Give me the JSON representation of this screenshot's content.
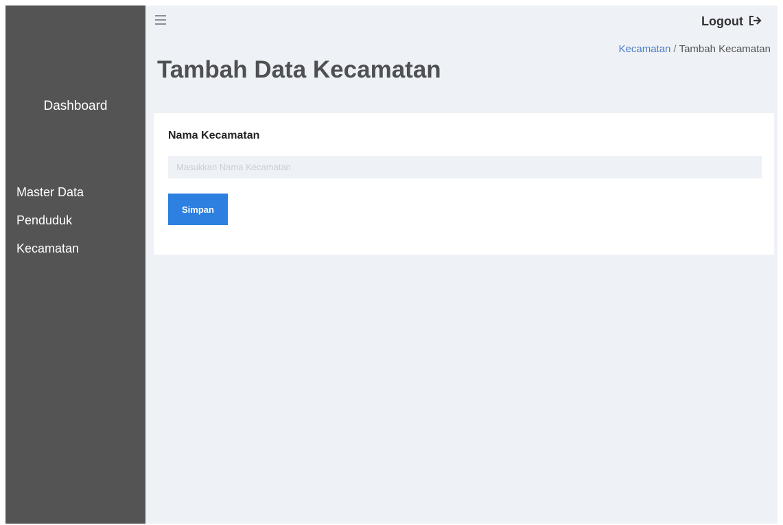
{
  "sidebar": {
    "brand": "Dashboard",
    "section_title": "Master Data",
    "items": [
      {
        "label": "Penduduk"
      },
      {
        "label": "Kecamatan"
      }
    ]
  },
  "header": {
    "menu_icon": "hamburger-icon",
    "logout_label": "Logout",
    "logout_icon": "sign-out-icon"
  },
  "breadcrumb": {
    "link": "Kecamatan",
    "separator": "/",
    "current": "Tambah Kecamatan"
  },
  "page_title": "Tambah Data Kecamatan",
  "form": {
    "field_label": "Nama Kecamatan",
    "field_placeholder": "Masukkan Nama Kecamatan",
    "field_value": "",
    "submit_label": "Simpan"
  },
  "colors": {
    "sidebar_bg": "#545454",
    "main_bg": "#eef2f6",
    "accent": "#2d7fe0",
    "breadcrumb_link": "#4a7cc8"
  }
}
